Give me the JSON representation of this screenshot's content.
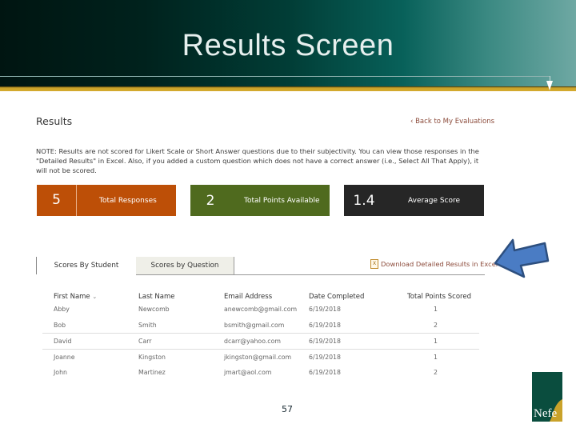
{
  "slide": {
    "title": "Results Screen",
    "page_number": "57",
    "colors": {
      "header_dark": "#001511",
      "header_teal": "#08615a",
      "gold_band": "#d6ab2e",
      "arrow_fill": "#4a7cc4",
      "arrow_stroke": "#2d4f7f"
    }
  },
  "page": {
    "heading": "Results",
    "back_link": "‹ Back to My Evaluations",
    "note": "NOTE: Results are not scored for Likert Scale or Short Answer questions due to their subjectivity. You can view those responses in the \"Detailed Results\" in Excel. Also, if you added a custom question which does not have a correct answer (i.e., Select All That Apply), it will not be scored."
  },
  "stats": [
    {
      "value": "5",
      "label": "Total Responses",
      "color": "#bd4f07"
    },
    {
      "value": "2",
      "label": "Total Points Available",
      "color": "#4f6a1e"
    },
    {
      "value": "1.4",
      "label": "Average Score",
      "color": "#262626"
    }
  ],
  "tabs": [
    {
      "label": "Scores By Student",
      "active": true
    },
    {
      "label": "Scores by Question",
      "active": false
    }
  ],
  "download": {
    "label": "Download Detailed Results in Excel",
    "icon": "excel-file-icon"
  },
  "table": {
    "columns": [
      "First Name",
      "Last Name",
      "Email Address",
      "Date Completed",
      "Total Points Scored"
    ],
    "sort_icon": "chevron-down-icon",
    "rows": [
      [
        "Abby",
        "Newcomb",
        "anewcomb@gmail.com",
        "6/19/2018",
        "1"
      ],
      [
        "Bob",
        "Smith",
        "bsmith@gmail.com",
        "6/19/2018",
        "2"
      ],
      [
        "David",
        "Carr",
        "dcarr@yahoo.com",
        "6/19/2018",
        "1"
      ],
      [
        "Joanne",
        "Kingston",
        "jkingston@gmail.com",
        "6/19/2018",
        "1"
      ],
      [
        "John",
        "Martinez",
        "jmart@aol.com",
        "6/19/2018",
        "2"
      ]
    ]
  },
  "logo": {
    "text": "Nefe"
  }
}
